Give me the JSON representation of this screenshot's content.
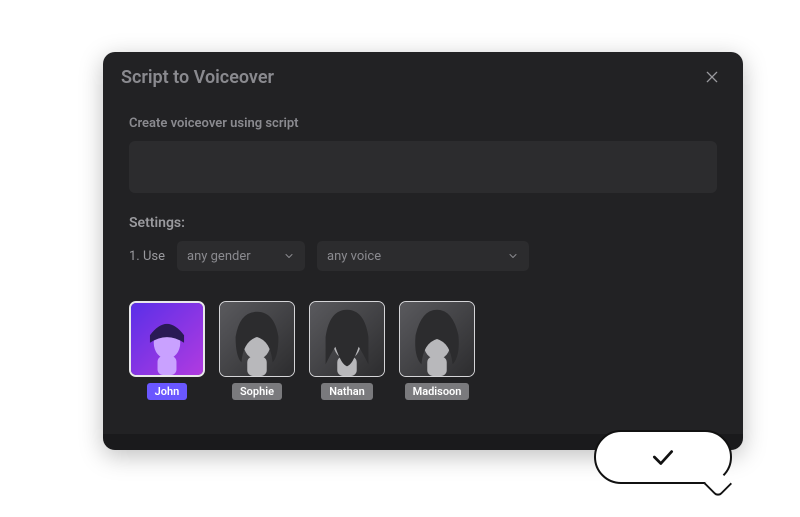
{
  "dialog": {
    "title": "Script to Voiceover",
    "script_label": "Create voiceover using script",
    "script_value": "",
    "settings_label": "Settings:",
    "row1_lead": "1. Use",
    "gender_select": {
      "value": "any gender"
    },
    "voice_select": {
      "value": "any voice"
    }
  },
  "voices": [
    {
      "name": "John",
      "selected": true,
      "tint": "purple"
    },
    {
      "name": "Sophie",
      "selected": false,
      "tint": "bw"
    },
    {
      "name": "Nathan",
      "selected": false,
      "tint": "bw"
    },
    {
      "name": "Madisoon",
      "selected": false,
      "tint": "bw"
    }
  ],
  "icons": {
    "close": "close-icon",
    "chevron": "chevron-down-icon",
    "check": "check-icon"
  }
}
